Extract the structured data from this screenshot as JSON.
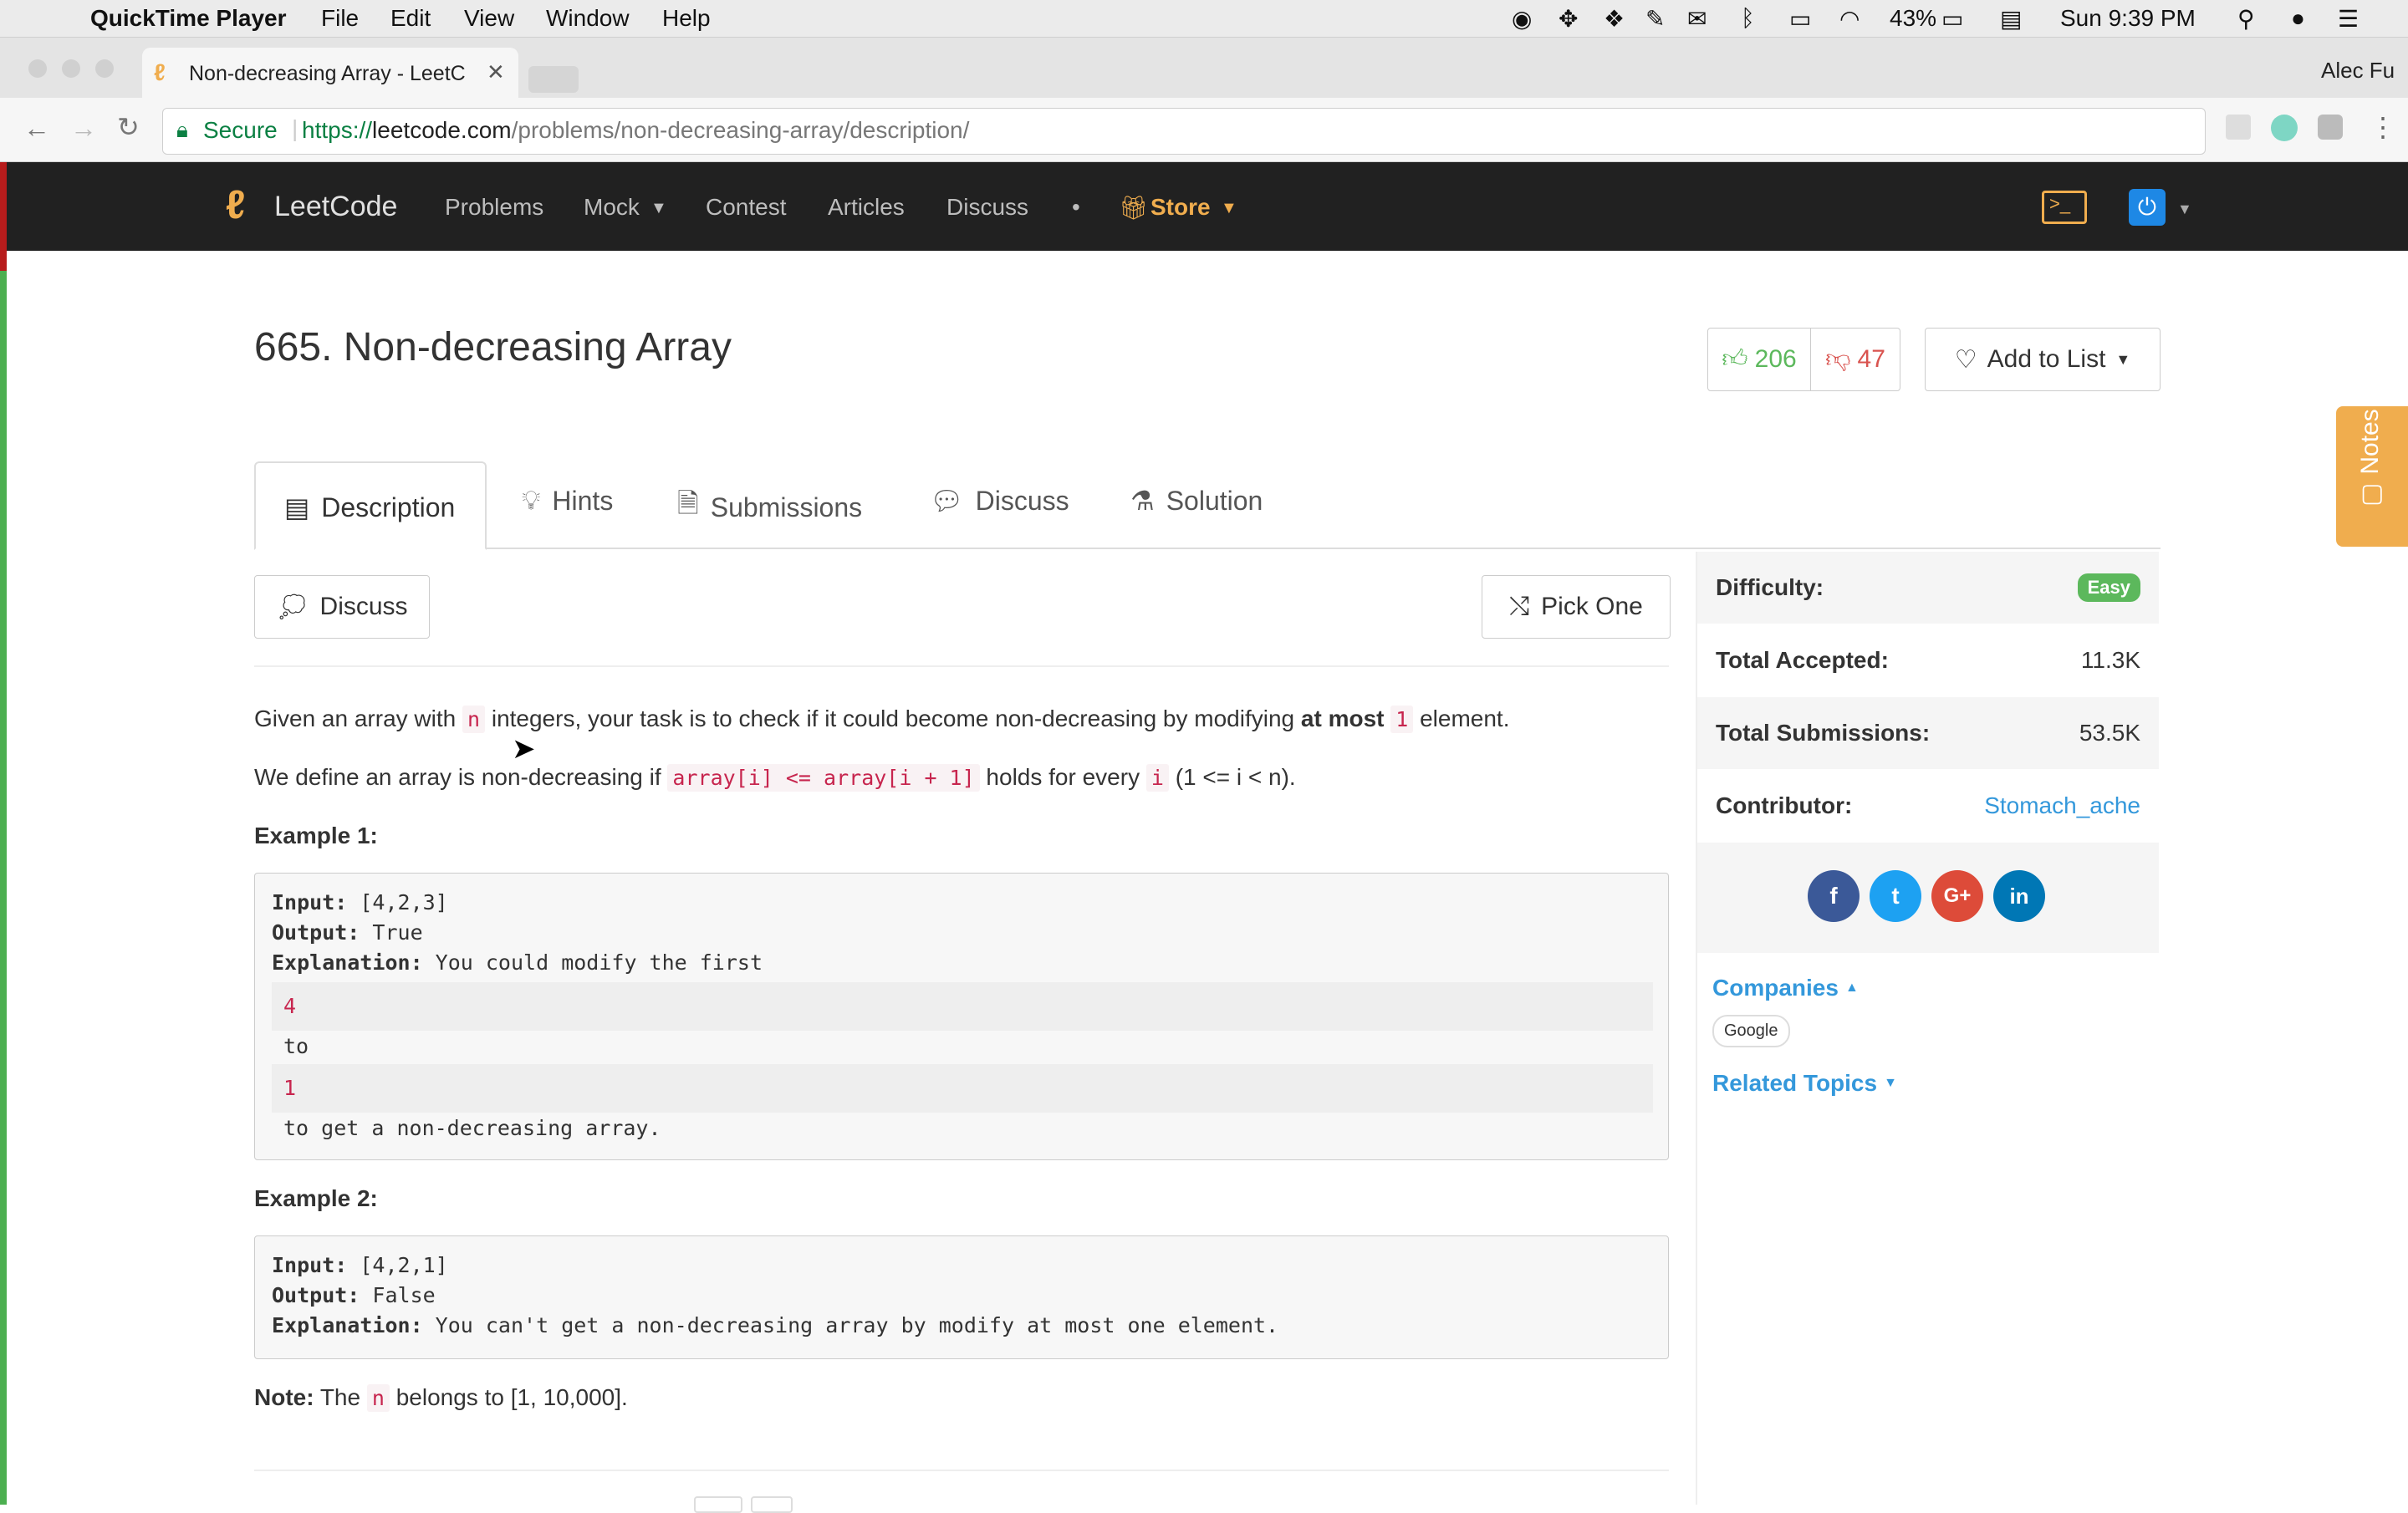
{
  "menubar": {
    "app": "QuickTime Player",
    "items": [
      "File",
      "Edit",
      "View",
      "Window",
      "Help"
    ],
    "battery": "43%",
    "clock": "Sun 9:39 PM"
  },
  "browser": {
    "tab_title": "Non-decreasing Array - LeetC",
    "profile": "Alec Fu",
    "secure": "Secure",
    "url_scheme": "https://",
    "url_host": "leetcode.com",
    "url_path": "/problems/non-decreasing-array/description/"
  },
  "nav": {
    "brand": "LeetCode",
    "items": [
      "Problems",
      "Mock",
      "Contest",
      "Articles",
      "Discuss"
    ],
    "store": "Store"
  },
  "problem": {
    "title": "665. Non-decreasing Array",
    "likes": "206",
    "dislikes": "47",
    "add_to_list": "Add to List"
  },
  "tabs": [
    "Description",
    "Hints",
    "Submissions",
    "Discuss",
    "Solution"
  ],
  "actions": {
    "discuss": "Discuss",
    "pick_one": "Pick One"
  },
  "desc": {
    "p1_a": "Given an array with ",
    "p1_code1": "n",
    "p1_b": " integers, your task is to check if it could become non-decreasing by modifying ",
    "p1_bold": "at most",
    "p1_code2": "1",
    "p1_c": " element.",
    "p2_a": "We define an array is non-decreasing if ",
    "p2_code1": "array[i] <= array[i + 1]",
    "p2_b": " holds for every ",
    "p2_code2": "i",
    "p2_c": " (1 <= i < n).",
    "ex1_title": "Example 1:",
    "ex1_input_label": "Input:",
    "ex1_input": " [4,2,3]",
    "ex1_output_label": "Output:",
    "ex1_output": " True",
    "ex1_expl_label": "Explanation:",
    "ex1_expl": " You could modify the first",
    "ex1_hl1": "4",
    "ex1_to": "to",
    "ex1_hl2": "1",
    "ex1_end": "to get a non-decreasing array.",
    "ex2_title": "Example 2:",
    "ex2_input_label": "Input:",
    "ex2_input": " [4,2,1]",
    "ex2_output_label": "Output:",
    "ex2_output": " False",
    "ex2_expl_label": "Explanation:",
    "ex2_expl": " You can't get a non-decreasing array by modify at most one element.",
    "note_label": "Note:",
    "note_a": " The ",
    "note_code": "n",
    "note_b": " belongs to [1, 10,000]."
  },
  "sidebar": {
    "difficulty_label": "Difficulty:",
    "difficulty": "Easy",
    "accepted_label": "Total Accepted:",
    "accepted": "11.3K",
    "submissions_label": "Total Submissions:",
    "submissions": "53.5K",
    "contributor_label": "Contributor:",
    "contributor": "Stomach_ache",
    "companies": "Companies",
    "company_tag": "Google",
    "related": "Related Topics"
  },
  "notes_tab": "Notes",
  "colors": {
    "accent": "#3498db",
    "store": "#f0ad4e",
    "like": "#5cb85c",
    "dislike": "#d9534f",
    "easy": "#5cb85c"
  }
}
